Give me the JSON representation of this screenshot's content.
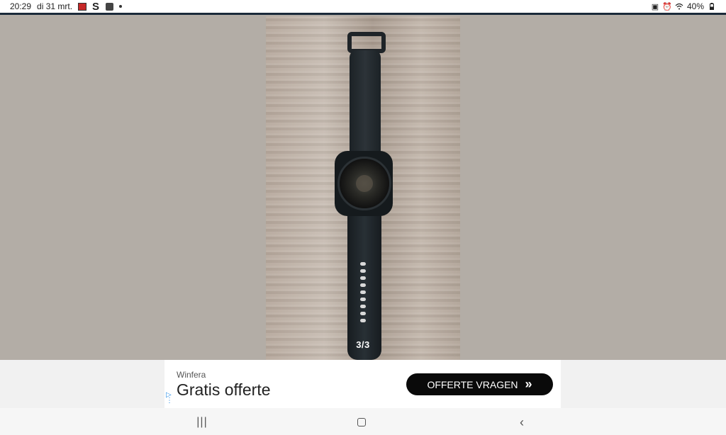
{
  "status_bar": {
    "time": "20:29",
    "date": "di 31 mrt.",
    "battery": "40%",
    "icons_left": [
      "app-icon-red",
      "s-icon",
      "app-icon-face",
      "dot-icon"
    ],
    "icons_right": [
      "lock-icon",
      "alarm-icon",
      "wifi-icon",
      "battery-icon"
    ]
  },
  "viewer": {
    "image_counter": "3/3"
  },
  "ad": {
    "brand": "Winfera",
    "headline": "Gratis offerte",
    "button_label": "OFFERTE VRAGEN",
    "button_icon": "double-chevron-right-icon"
  },
  "nav_bar": {
    "buttons": [
      "recents-icon",
      "home-icon",
      "back-icon"
    ]
  },
  "colors": {
    "background": "#b3ada6",
    "ad_button": "#0a0a0a",
    "accent_line": "#1b2a3a"
  }
}
